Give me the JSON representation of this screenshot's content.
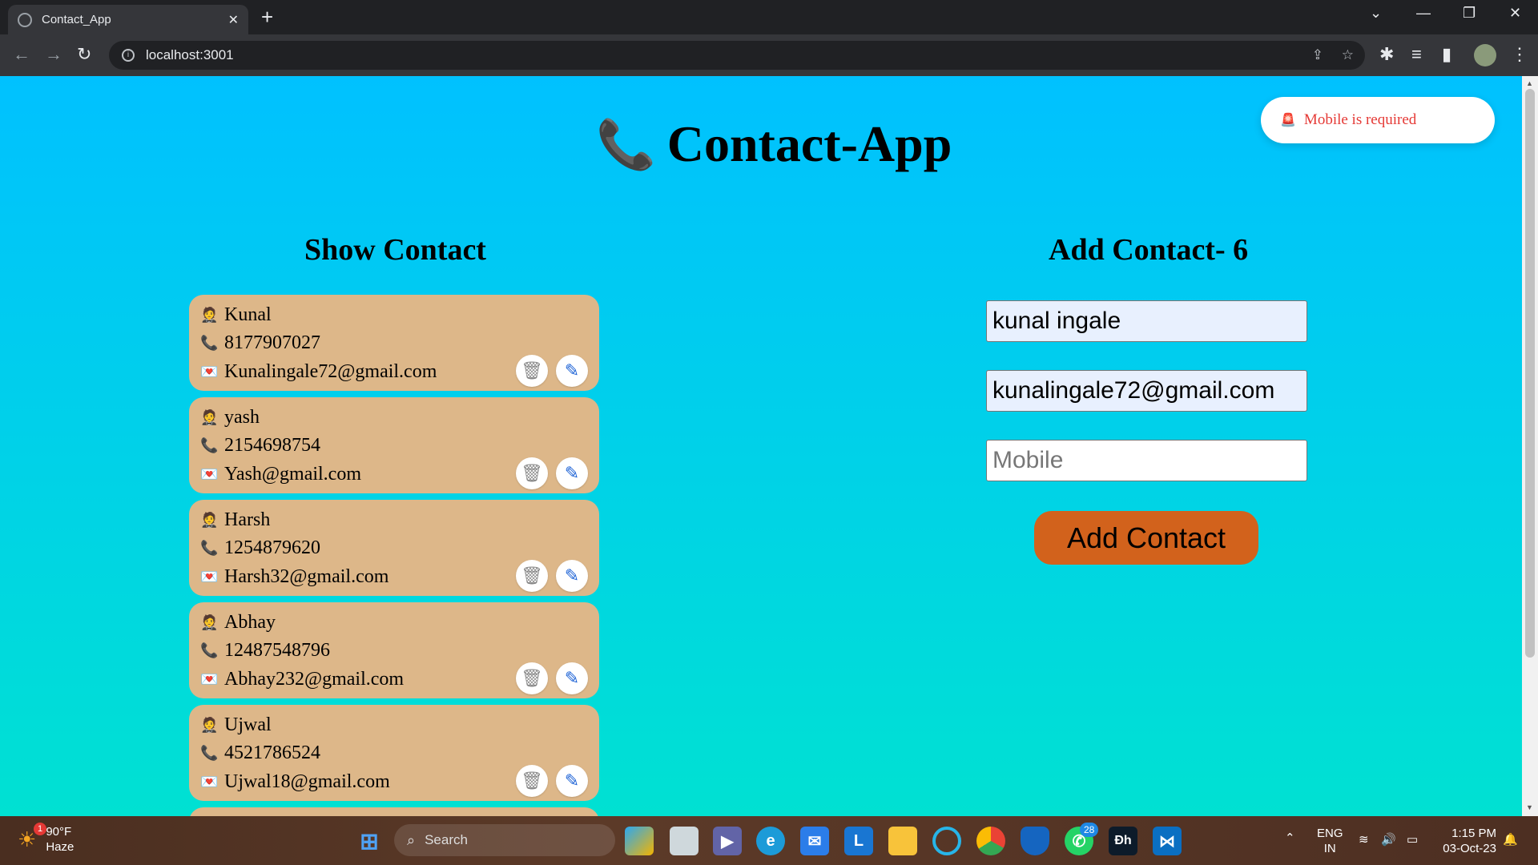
{
  "browser": {
    "tab_title": "Contact_App",
    "url": "localhost:3001"
  },
  "app": {
    "title": "Contact-App",
    "toast": "Mobile is required",
    "show_heading": "Show Contact",
    "add_heading": "Add Contact- 6",
    "contacts": [
      {
        "name": "Kunal",
        "mobile": "8177907027",
        "email": "Kunalingale72@gmail.com"
      },
      {
        "name": "yash",
        "mobile": "2154698754",
        "email": "Yash@gmail.com"
      },
      {
        "name": "Harsh",
        "mobile": "1254879620",
        "email": "Harsh32@gmail.com"
      },
      {
        "name": "Abhay",
        "mobile": "12487548796",
        "email": "Abhay232@gmail.com"
      },
      {
        "name": "Ujwal",
        "mobile": "4521786524",
        "email": "Ujwal18@gmail.com"
      }
    ],
    "form": {
      "name_value": "kunal ingale",
      "email_value": "kunalingale72@gmail.com",
      "mobile_placeholder": "Mobile",
      "submit_label": "Add Contact"
    }
  },
  "taskbar": {
    "temperature": "90°F",
    "condition": "Haze",
    "weather_badge": "1",
    "search_label": "Search",
    "whatsapp_badge": "28",
    "language": "ENG",
    "region": "IN",
    "time": "1:15 PM",
    "date": "03-Oct-23"
  }
}
